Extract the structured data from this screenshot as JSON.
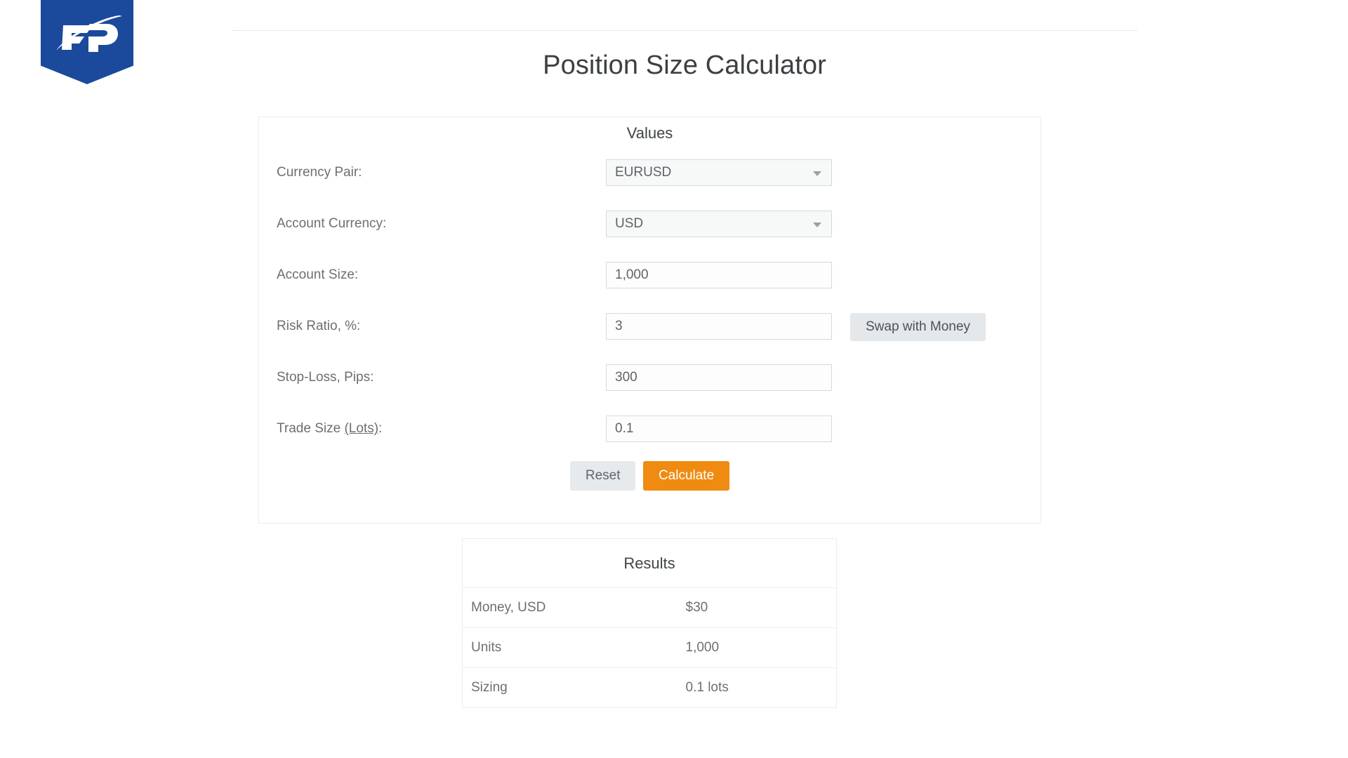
{
  "brand": {
    "logo_text": "FP",
    "logo_color": "#1b4a9c"
  },
  "header": {
    "title": "Position Size Calculator"
  },
  "form": {
    "section_title": "Values",
    "fields": [
      {
        "label": "Currency Pair:",
        "type": "select",
        "value": "EURUSD",
        "icon": "chevron-down-icon",
        "name": "currency-pair"
      },
      {
        "label": "Account Currency:",
        "type": "select",
        "value": "USD",
        "icon": "chevron-down-icon",
        "name": "account-currency"
      },
      {
        "label": "Account Size:",
        "type": "text",
        "value": "1,000",
        "name": "account-size"
      },
      {
        "label": "Risk Ratio, %:",
        "type": "text",
        "value": "3",
        "name": "risk-ratio"
      },
      {
        "label": "Stop-Loss, Pips:",
        "type": "text",
        "value": "300",
        "name": "stop-loss-pips"
      },
      {
        "label": "Trade Size ",
        "label_underlined": "(Lots)",
        "label_tail": ":",
        "type": "text",
        "value": "0.1",
        "name": "trade-size-lots"
      }
    ],
    "swap_button_label": "Swap with Money",
    "reset_button_label": "Reset",
    "calculate_button_label": "Calculate",
    "accent_color": "#ef8b11"
  },
  "results": {
    "section_title": "Results",
    "rows": [
      {
        "label": "Money, USD",
        "value": "$30"
      },
      {
        "label": "Units",
        "value": "1,000"
      },
      {
        "label": "Sizing",
        "value": "0.1 lots"
      }
    ]
  }
}
